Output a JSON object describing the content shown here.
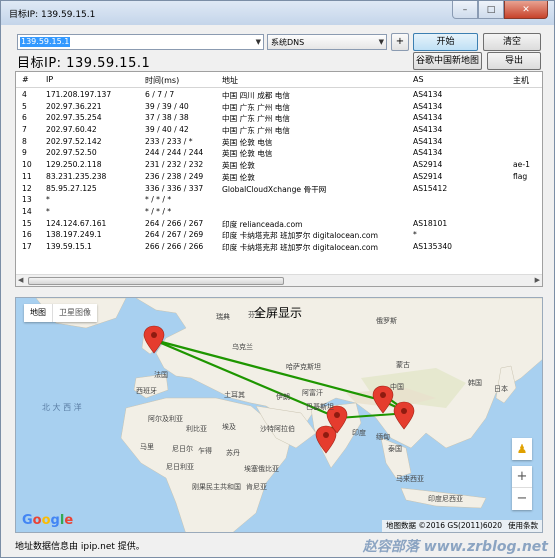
{
  "window": {
    "title": "目标IP: 139.59.15.1",
    "controls": {
      "minimize": "–",
      "maximize": "□",
      "close": "✕"
    }
  },
  "toolbar": {
    "ip_input_value": "139.59.15.1",
    "dns_select_value": "系统DNS",
    "plus_label": "+",
    "start_label": "开始",
    "clear_label": "清空",
    "target_label": "目标IP:  139.59.15.1",
    "google_china_map_label": "谷歌中国新地图",
    "export_label": "导出"
  },
  "table": {
    "columns": [
      "#",
      "IP",
      "时间(ms)",
      "地址",
      "AS",
      "主机"
    ],
    "rows": [
      [
        "4",
        "171.208.197.137",
        "6 / 7 / 7",
        "中国 四川 成都 电信",
        "AS4134",
        ""
      ],
      [
        "5",
        "202.97.36.221",
        "39 / 39 / 40",
        "中国 广东 广州 电信",
        "AS4134",
        ""
      ],
      [
        "6",
        "202.97.35.254",
        "37 / 38 / 38",
        "中国 广东 广州 电信",
        "AS4134",
        ""
      ],
      [
        "7",
        "202.97.60.42",
        "39 / 40 / 42",
        "中国 广东 广州 电信",
        "AS4134",
        ""
      ],
      [
        "8",
        "202.97.52.142",
        "233 / 233 / *",
        "英国 伦敦 电信",
        "AS4134",
        ""
      ],
      [
        "9",
        "202.97.52.50",
        "244 / 244 / 244",
        "英国 伦敦 电信",
        "AS4134",
        ""
      ],
      [
        "10",
        "129.250.2.118",
        "231 / 232 / 232",
        "英国 伦敦",
        "AS2914",
        "ae-1"
      ],
      [
        "11",
        "83.231.235.238",
        "236 / 238 / 249",
        "英国 伦敦",
        "AS2914",
        "flag"
      ],
      [
        "12",
        "85.95.27.125",
        "336 / 336 / 337",
        "GlobalCloudXchange 骨干网",
        "AS15412",
        ""
      ],
      [
        "13",
        "*",
        "* / * / *",
        "",
        "",
        ""
      ],
      [
        "14",
        "*",
        "* / * / *",
        "",
        "",
        ""
      ],
      [
        "15",
        "124.124.67.161",
        "264 / 266 / 267",
        "印度 relianceada.com",
        "AS18101",
        ""
      ],
      [
        "16",
        "138.197.249.1",
        "264 / 267 / 269",
        "印度 卡纳塔克邦 班加罗尔 digitalocean.com",
        "*",
        ""
      ],
      [
        "17",
        "139.59.15.1",
        "266 / 266 / 266",
        "印度 卡纳塔克邦 班加罗尔 digitalocean.com",
        "AS135340",
        ""
      ]
    ]
  },
  "map": {
    "map_tab": "地图",
    "satellite_tab": "卫星图像",
    "fullscreen_label": "全屏显示",
    "google_logo": "Google",
    "attribution": "地图数据 ©2016 GS(2011)6020",
    "terms": "使用条款",
    "zoom_in": "+",
    "zoom_out": "−",
    "labels": {
      "atlantic": "北 大 西 洋",
      "sweden": "瑞典",
      "finland": "芬兰",
      "russia": "俄罗斯",
      "kazakhstan": "哈萨克斯坦",
      "mongolia": "蒙古",
      "china": "中国",
      "india": "印度",
      "iran": "伊朗",
      "turkey": "土耳其",
      "egypt": "埃及",
      "france": "法国",
      "spain": "西班牙",
      "algeria": "阿尔及利亚",
      "libya": "利比亚",
      "mali": "马里",
      "niger": "尼日尔",
      "chad": "乍得",
      "sudan": "苏丹",
      "nigeria": "尼日利亚",
      "ethiopia": "埃塞俄比亚",
      "saudi": "沙特阿拉伯",
      "pakistan": "巴基斯坦",
      "afghanistan": "阿富汗",
      "ukraine": "乌克兰",
      "drc": "刚果民主共和国",
      "kenya": "肯尼亚",
      "thailand": "泰国",
      "myanmar": "缅甸",
      "indonesia": "印度尼西亚",
      "malaysia": "马来西亚",
      "korea": "韩国",
      "japan": "日本"
    },
    "colors": {
      "water": "#a8d0f0",
      "land": "#f2efe6",
      "route": "#1e9600",
      "marker": "#e53c2e"
    }
  },
  "status": {
    "text": "地址数据信息由 ipip.net 提供。",
    "watermark": "赵容部落 www.zrblog.net"
  }
}
